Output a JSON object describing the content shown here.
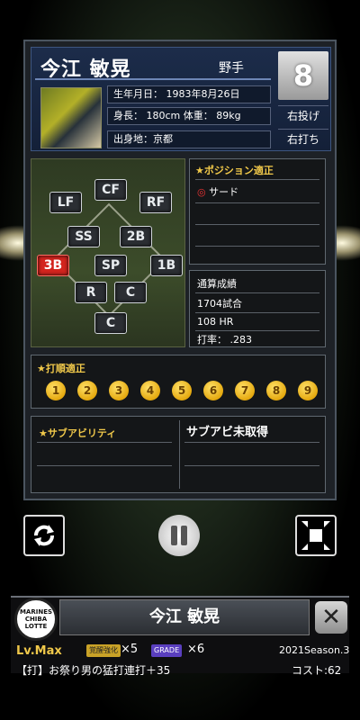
{
  "player": {
    "name": "今江 敏晃",
    "type": "野手",
    "number": "8",
    "throws": "右投げ",
    "bats": "右打ち",
    "birthday": "生年月日： 1983年8月26日",
    "size": "身長： 180cm 体重： 89kg",
    "birthplace": "出身地：京都"
  },
  "positions": [
    {
      "label": "CF",
      "active": false
    },
    {
      "label": "LF",
      "active": false
    },
    {
      "label": "RF",
      "active": false
    },
    {
      "label": "SS",
      "active": false
    },
    {
      "label": "2B",
      "active": false
    },
    {
      "label": "3B",
      "active": true
    },
    {
      "label": "SP",
      "active": false
    },
    {
      "label": "1B",
      "active": false
    },
    {
      "label": "R",
      "active": false
    },
    {
      "label": "C",
      "active": false
    },
    {
      "label": "C",
      "active": false
    }
  ],
  "position_aptitude": {
    "title": "★ポジション適正",
    "items": [
      {
        "marker": "◎",
        "label": "サード"
      }
    ]
  },
  "record": {
    "title": "通算成績",
    "games": "1704試合",
    "hr": "108 HR",
    "avg": "打率： .283"
  },
  "batting_order": {
    "title": "★打順適正",
    "numbers": [
      "1",
      "2",
      "3",
      "4",
      "5",
      "6",
      "7",
      "8",
      "9"
    ]
  },
  "sub_ability": {
    "title": "★サブアビリティ",
    "value": "サブアビ未取得"
  },
  "controls": {
    "refresh_icon": "refresh-icon",
    "pause_icon": "pause-icon",
    "collapse_icon": "collapse-icon"
  },
  "footer": {
    "logo_text": "MARINES CHIBA LOTTE",
    "name": "今江 敏晃",
    "close": "✕",
    "level": "Lv.Max",
    "awaken_label": "覚醒強化",
    "awaken_count": "×5",
    "grade_label": "GRADE",
    "grade_count": "×6",
    "season": "2021Season.3",
    "skill": "【打】お祭り男の猛打連打＋35",
    "cost": "コスト:62"
  }
}
